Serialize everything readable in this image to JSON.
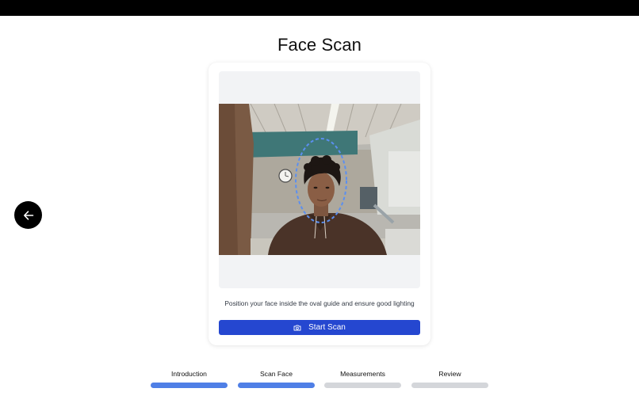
{
  "page": {
    "title": "Face Scan"
  },
  "nav": {
    "back_icon": "arrow-left-icon"
  },
  "scan_card": {
    "instruction": "Position your face inside the oval guide and ensure good lighting",
    "start_button_label": "Start Scan",
    "start_button_icon": "camera-icon",
    "accent_color": "#2547d0"
  },
  "steps": [
    {
      "label": "Introduction",
      "active": true
    },
    {
      "label": "Scan Face",
      "active": true
    },
    {
      "label": "Measurements",
      "active": false
    },
    {
      "label": "Review",
      "active": false
    }
  ],
  "colors": {
    "step_active": "#4f7fe6",
    "step_inactive": "#d4d6da"
  }
}
